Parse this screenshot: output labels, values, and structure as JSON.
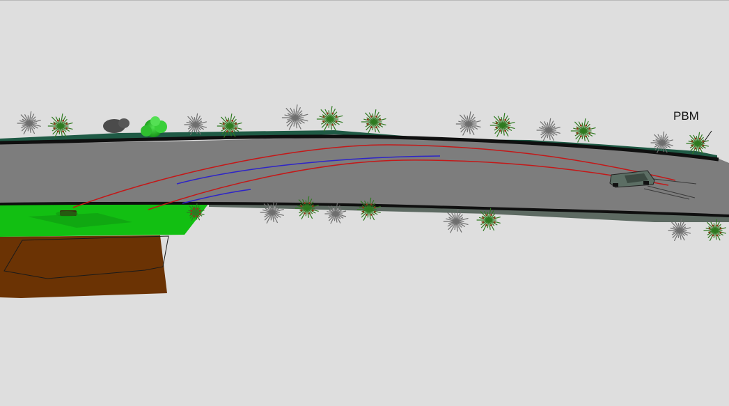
{
  "scene": {
    "label": "PBM",
    "colors": {
      "background": "#dedede",
      "road": "#7d7d7d",
      "road_edge": "#0f0f0f",
      "grass": "#12bf12",
      "soil": "#6b3304",
      "verge": "#1f5a45",
      "trajectory_red": "#c41818",
      "trajectory_blue": "#2e24c8",
      "vehicle": "#5c6e64"
    },
    "icons": {
      "tree": "tree-icon",
      "vehicle": "car-icon",
      "object": "debris-icon"
    }
  }
}
